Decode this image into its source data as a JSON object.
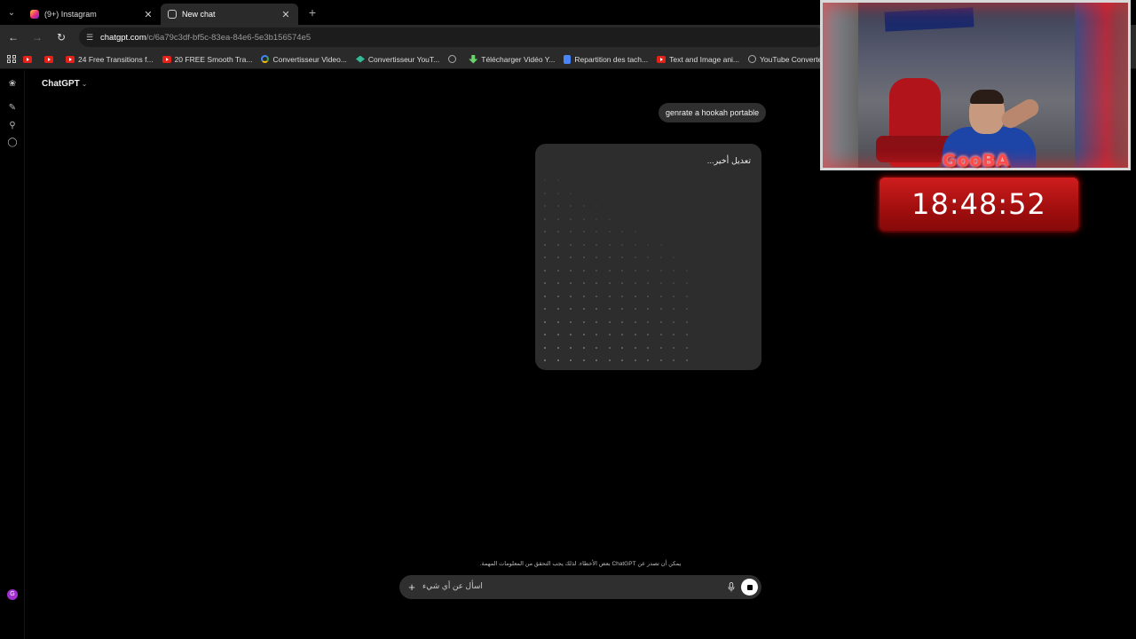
{
  "browser": {
    "tabs": [
      {
        "title": "(9+) Instagram",
        "favicon": "instagram-icon",
        "active": false
      },
      {
        "title": "New chat",
        "favicon": "chatgpt-icon",
        "active": true
      }
    ],
    "url": {
      "domain": "chatgpt.com",
      "path": "/c/6a79c3df-bf5c-83ea-84e6-5e3b156574e5"
    },
    "bookmarks": [
      {
        "label": "",
        "icon": "youtube-icon"
      },
      {
        "label": "",
        "icon": "youtube-icon"
      },
      {
        "label": "24 Free Transitions f...",
        "icon": "youtube-icon"
      },
      {
        "label": "20 FREE Smooth Tra...",
        "icon": "youtube-icon"
      },
      {
        "label": "Convertisseur Video...",
        "icon": "google-icon"
      },
      {
        "label": "Convertisseur YouT...",
        "icon": "converter-icon"
      },
      {
        "label": "",
        "icon": "globe-icon"
      },
      {
        "label": "Télécharger Vidéo Y...",
        "icon": "download-arrow-icon"
      },
      {
        "label": "Repartition des tach...",
        "icon": "docs-icon"
      },
      {
        "label": "Text and Image ani...",
        "icon": "youtube-icon"
      },
      {
        "label": "YouTube Converter...",
        "icon": "globe-icon"
      }
    ]
  },
  "chat": {
    "model_label": "ChatGPT",
    "user_message": "genrate a hookah portable",
    "image_status": "تعديل أخير...",
    "disclaimer": "يمكن أن تصدر عن ChatGPT بعض الأخطاء. لذلك يجب التحقق من المعلومات المهمة.",
    "composer_placeholder": "اسأل عن أي شيء",
    "avatar_letter": "G"
  },
  "overlay": {
    "streamer_name": "GooBA",
    "clock": "18:48:52"
  },
  "colors": {
    "page_bg": "#000000",
    "bubble_bg": "#2f2f2f",
    "clock_red": "#c41616"
  }
}
